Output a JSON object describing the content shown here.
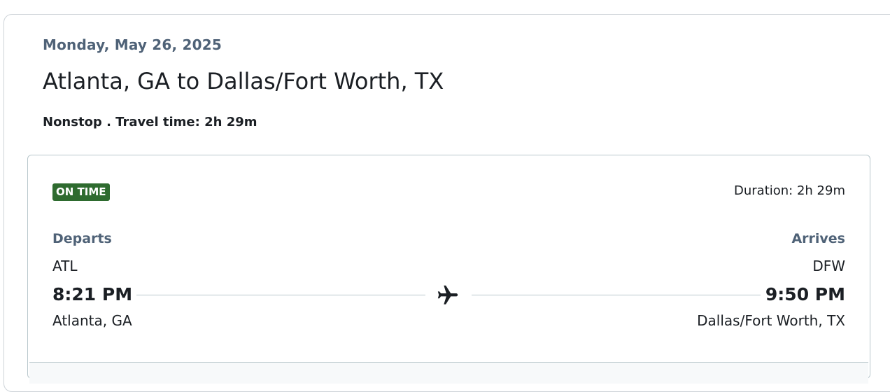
{
  "trip": {
    "date": "Monday, May 26, 2025",
    "title": "Atlanta, GA to Dallas/Fort Worth, TX",
    "summary": "Nonstop . Travel time: 2h 29m"
  },
  "segment": {
    "status": "ON TIME",
    "status_color": "#2e6b2f",
    "duration": "Duration: 2h 29m",
    "depart": {
      "label": "Departs",
      "code": "ATL",
      "time": "8:21 PM",
      "city": "Atlanta, GA"
    },
    "arrive": {
      "label": "Arrives",
      "code": "DFW",
      "time": "9:50 PM",
      "city": "Dallas/Fort Worth, TX"
    },
    "icon": "airplane-icon"
  }
}
